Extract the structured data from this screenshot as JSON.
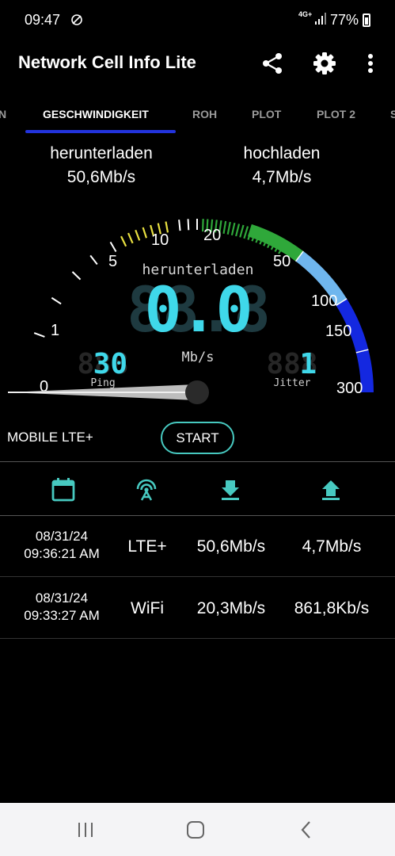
{
  "status_bar": {
    "time": "09:47",
    "network": "4G+",
    "battery": "77%"
  },
  "app": {
    "title": "Network Cell Info Lite"
  },
  "tabs": [
    {
      "label": "N"
    },
    {
      "label": "GESCHWINDIGKEIT"
    },
    {
      "label": "ROH"
    },
    {
      "label": "PLOT"
    },
    {
      "label": "PLOT 2"
    },
    {
      "label": "S"
    }
  ],
  "speeds": {
    "download_label": "herunterladen",
    "download_value": "50,6Mb/s",
    "upload_label": "hochladen",
    "upload_value": "4,7Mb/s"
  },
  "gauge": {
    "center_label": "herunterladen",
    "digital_value": "0.0",
    "unit": "Mb/s",
    "ping_value": "30",
    "ping_label": "Ping",
    "jitter_value": "1",
    "jitter_label": "Jitter",
    "needle_value": 0,
    "scale_labels": [
      "0",
      "1",
      "5",
      "10",
      "20",
      "50",
      "100",
      "150",
      "300"
    ],
    "colors": {
      "white": "#ffffff",
      "yellow": "#e8e040",
      "green": "#2fa83a",
      "light_blue": "#6fb6ee",
      "blue": "#1428e0",
      "digits": "#3fd8ea"
    }
  },
  "controls": {
    "connection_label": "MOBILE LTE+",
    "start_label": "START"
  },
  "history_icons": [
    "calendar-icon",
    "antenna-icon",
    "download-icon",
    "upload-icon"
  ],
  "history": [
    {
      "date": "08/31/24",
      "time": "09:36:21 AM",
      "type": "LTE+",
      "down": "50,6Mb/s",
      "up": "4,7Mb/s"
    },
    {
      "date": "08/31/24",
      "time": "09:33:27 AM",
      "type": "WiFi",
      "down": "20,3Mb/s",
      "up": "861,8Kb/s"
    }
  ],
  "accent_color": "#47c9c0"
}
